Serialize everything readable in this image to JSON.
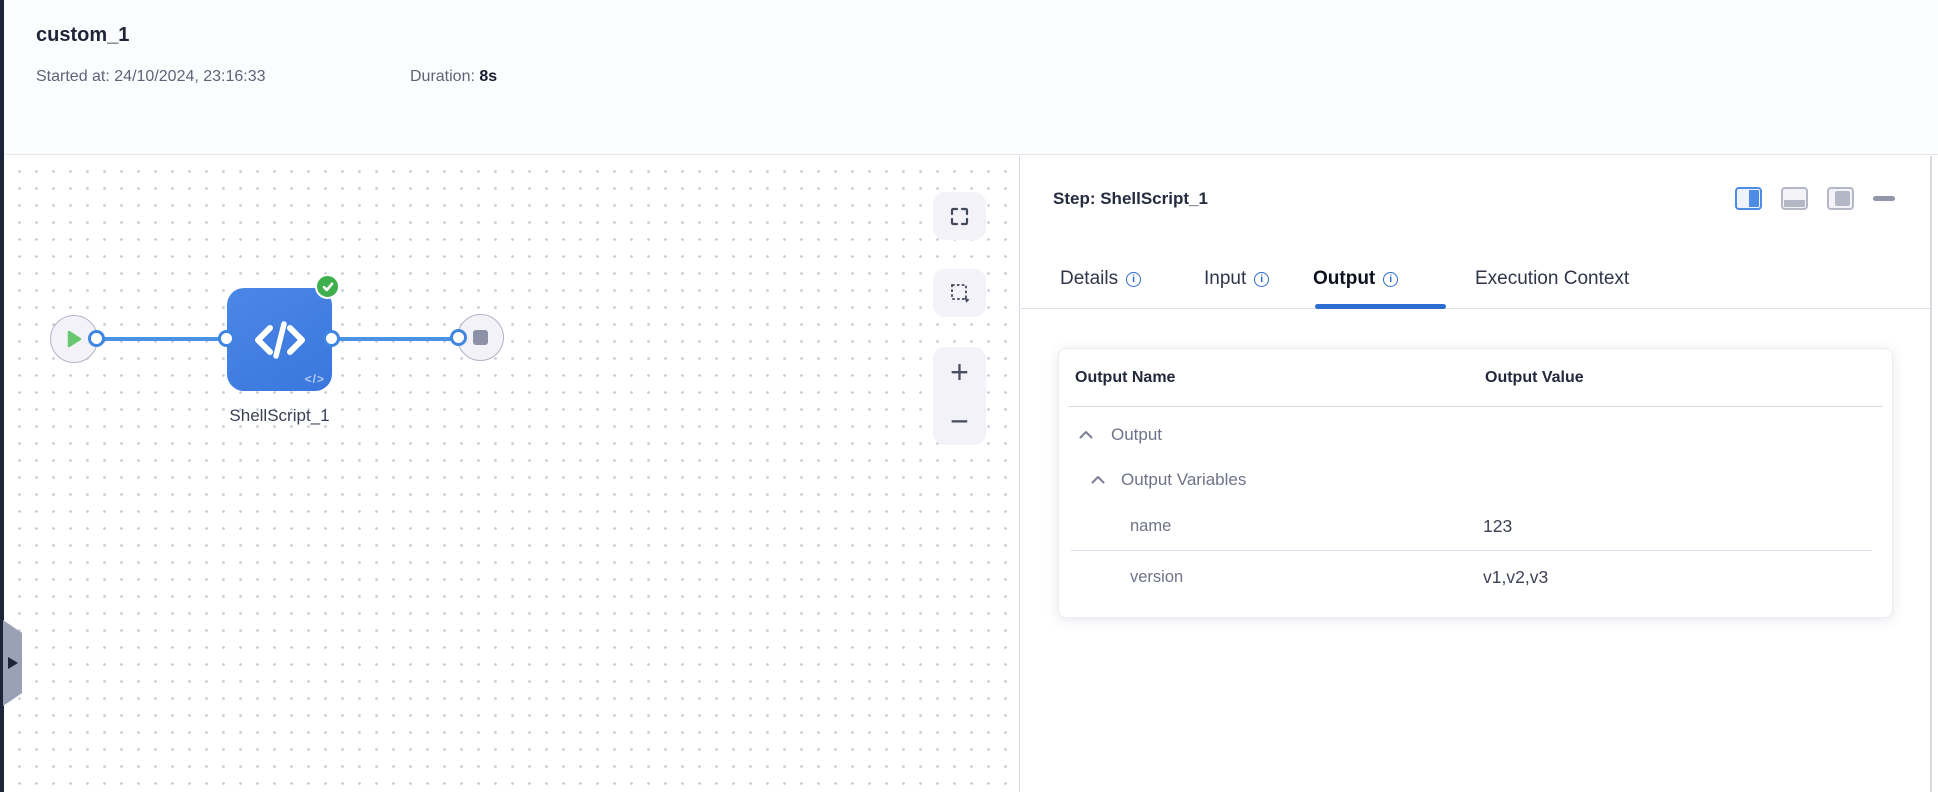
{
  "header": {
    "title": "custom_1",
    "started_label": "Started at:",
    "started_value": "24/10/2024, 23:16:33",
    "duration_label": "Duration:",
    "duration_value": "8s"
  },
  "canvas": {
    "node_label": "ShellScript_1",
    "code_glyph": "</>",
    "zoom_in_glyph": "+",
    "zoom_out_glyph": "−",
    "icons": {
      "start": "play-icon",
      "end": "stop-icon",
      "step": "code-icon",
      "status": "success-check-icon"
    }
  },
  "panel": {
    "step_title": "Step: ShellScript_1",
    "info_glyph": "i",
    "tabs": [
      {
        "label": "Details",
        "has_info": true,
        "active": false
      },
      {
        "label": "Input",
        "has_info": true,
        "active": false
      },
      {
        "label": "Output",
        "has_info": true,
        "active": true
      },
      {
        "label": "Execution Context",
        "has_info": false,
        "active": false
      }
    ],
    "table": {
      "col_name": "Output Name",
      "col_value": "Output Value",
      "groups": [
        {
          "label": "Output",
          "expanded": true
        },
        {
          "label": "Output Variables",
          "expanded": true
        }
      ],
      "rows": [
        {
          "name": "name",
          "value": "123"
        },
        {
          "name": "version",
          "value": "v1,v2,v3"
        }
      ]
    }
  },
  "colors": {
    "accent_blue": "#2e6ed3",
    "connector_blue": "#4a92e4",
    "node_blue": "#3f7de0",
    "success_green": "#3fae4c",
    "sidebar_dark": "#1d2438"
  }
}
